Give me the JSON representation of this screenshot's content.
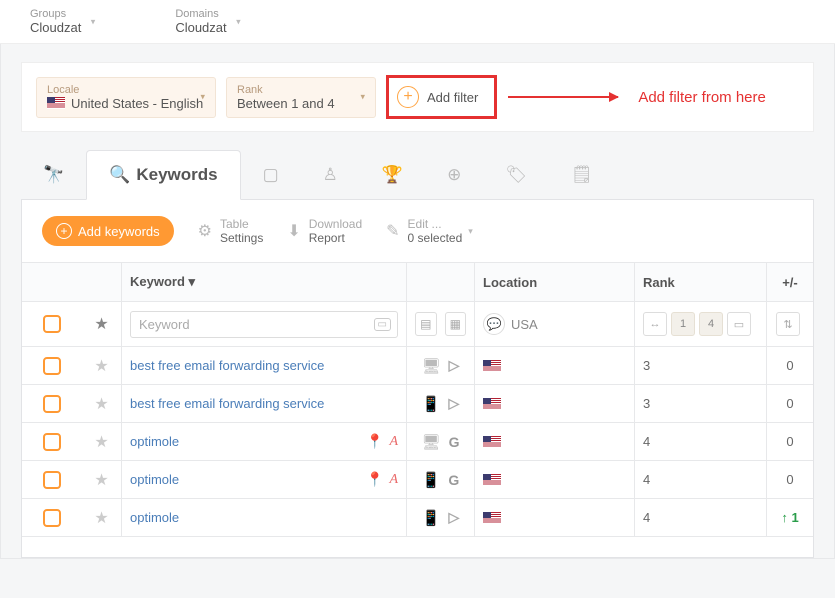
{
  "top": {
    "groups": {
      "label": "Groups",
      "value": "Cloudzat"
    },
    "domains": {
      "label": "Domains",
      "value": "Cloudzat"
    }
  },
  "filters": {
    "locale": {
      "label": "Locale",
      "value": "United States - English"
    },
    "rank": {
      "label": "Rank",
      "value": "Between 1 and 4"
    },
    "add_label": "Add filter"
  },
  "annotation": "Add filter from here",
  "tabs": {
    "keywords": "Keywords"
  },
  "toolbar": {
    "add_keywords": "Add keywords",
    "table": {
      "l1": "Table",
      "l2": "Settings"
    },
    "download": {
      "l1": "Download",
      "l2": "Report"
    },
    "edit": {
      "l1": "Edit ...",
      "l2": "0 selected"
    }
  },
  "headers": {
    "keyword": "Keyword ▾",
    "location": "Location",
    "rank": "Rank",
    "pm": "+/-"
  },
  "filter_row": {
    "keyword_placeholder": "Keyword",
    "location_value": "USA",
    "rank_low": "1",
    "rank_high": "4"
  },
  "rows": [
    {
      "keyword": "best free email forwarding service",
      "map": false,
      "lang": false,
      "device": "desktop",
      "engine": "bing",
      "rank": "3",
      "pm": "0",
      "pm_dir": "none"
    },
    {
      "keyword": "best free email forwarding service",
      "map": false,
      "lang": false,
      "device": "mobile",
      "engine": "bing",
      "rank": "3",
      "pm": "0",
      "pm_dir": "none"
    },
    {
      "keyword": "optimole",
      "map": true,
      "lang": true,
      "device": "desktop",
      "engine": "google",
      "rank": "4",
      "pm": "0",
      "pm_dir": "none"
    },
    {
      "keyword": "optimole",
      "map": true,
      "lang": true,
      "device": "mobile",
      "engine": "google",
      "rank": "4",
      "pm": "0",
      "pm_dir": "none"
    },
    {
      "keyword": "optimole",
      "map": false,
      "lang": false,
      "device": "mobile",
      "engine": "bing",
      "rank": "4",
      "pm": "1",
      "pm_dir": "up"
    }
  ]
}
